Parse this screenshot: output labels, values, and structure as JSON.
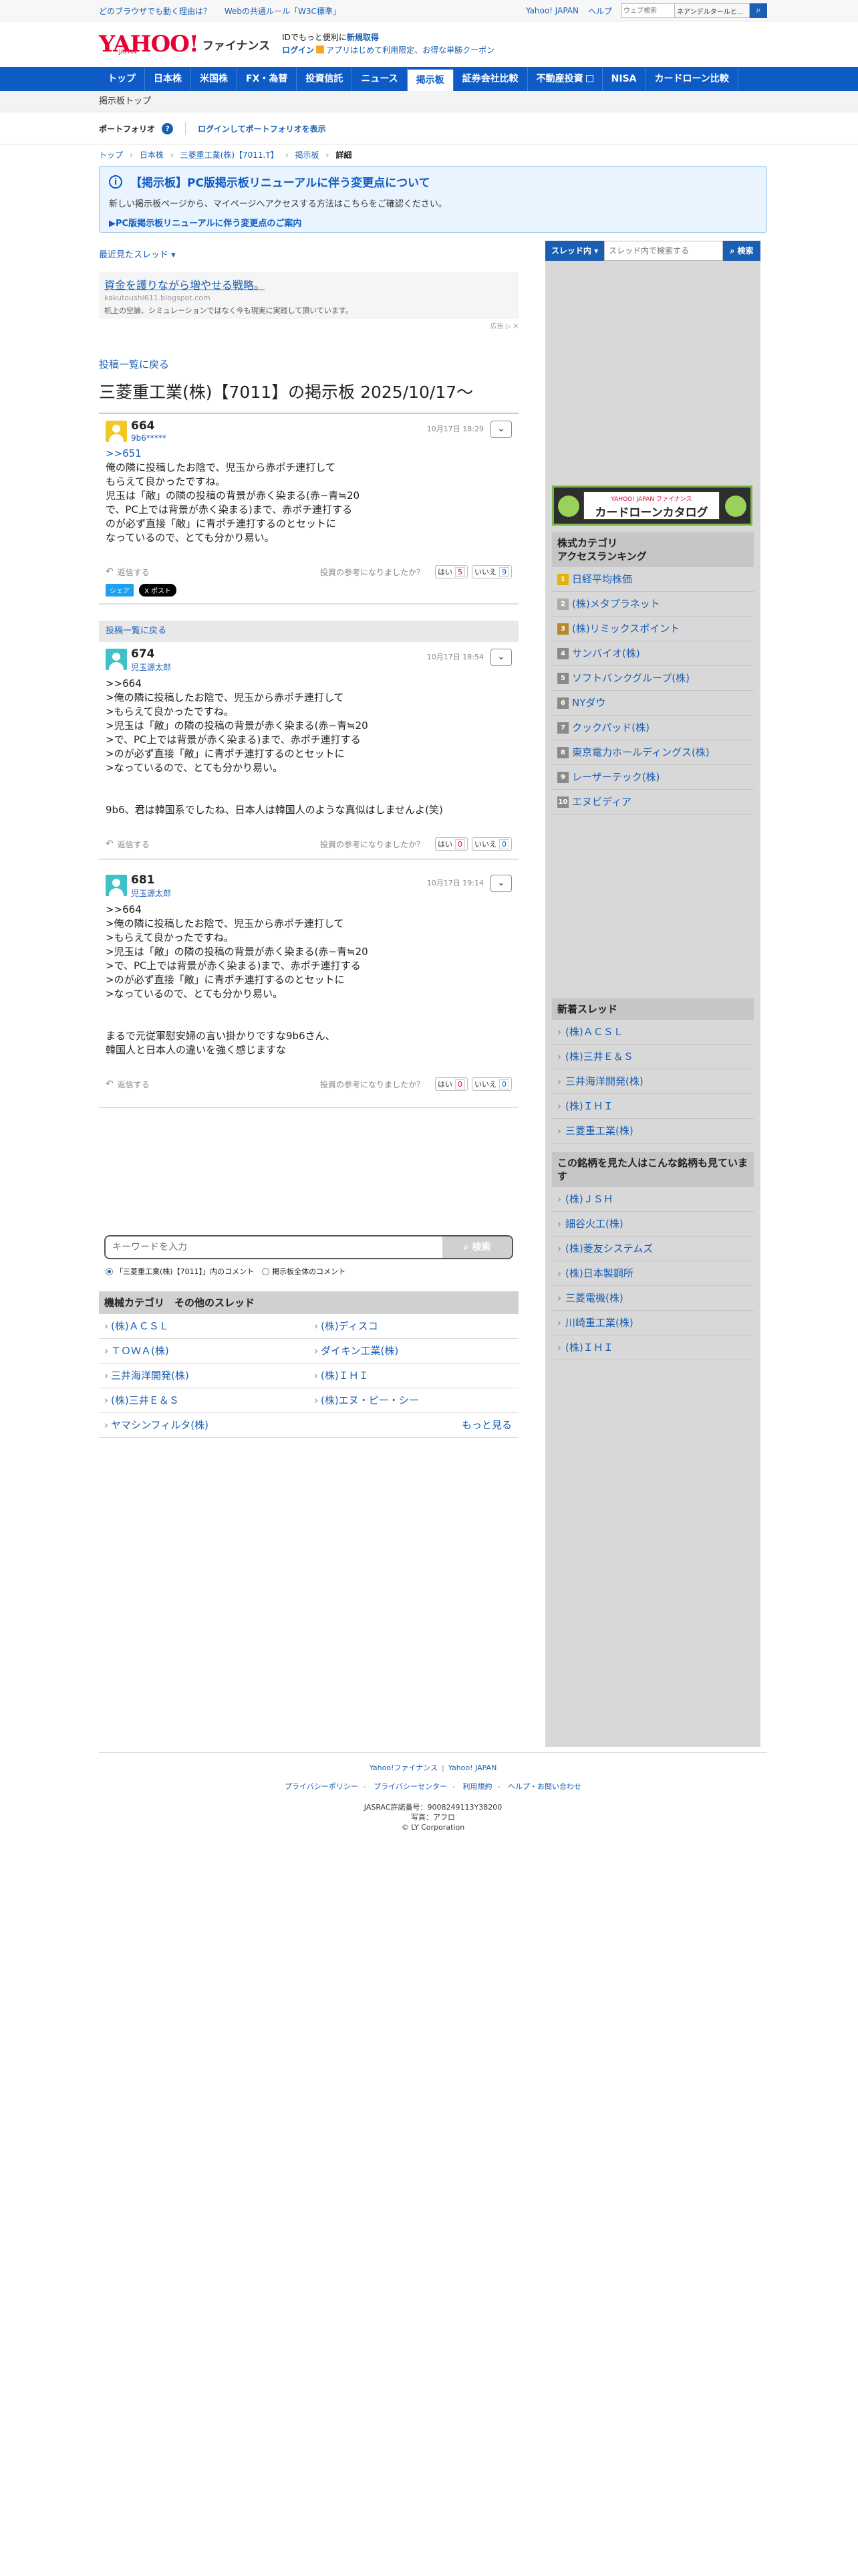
{
  "topbar": {
    "left_links": [
      "どのブラウザでも動く理由は？",
      "Webの共通ルール「W3C標準」"
    ],
    "right_links": [
      "Yahoo! JAPAN",
      "ヘルプ"
    ],
    "search_placeholder": "ウェブ検索",
    "search_select": "ネアンデルタールと...",
    "search_icon": "search-icon"
  },
  "header": {
    "logo_text": "YAHOO!",
    "logo_sub": "JAPAN",
    "logo_service": "ファイナンス",
    "promo_line1": "IDでもっと便利に",
    "promo_line1_link": "新規取得",
    "login": "ログイン",
    "promo_line2": "アプリはじめて利用限定、お得な単勝クーポン"
  },
  "gnav": {
    "items": [
      "トップ",
      "日本株",
      "米国株",
      "FX・為替",
      "投資信託",
      "ニュース",
      "掲示板",
      "証券会社比較",
      "不動産投資",
      "NISA",
      "カードローン比較"
    ],
    "active": "掲示板"
  },
  "subnav": {
    "label": "掲示板トップ"
  },
  "portfolio": {
    "label": "ポートフォリオ",
    "help": "?",
    "login_link": "ログインしてポートフォリオを表示"
  },
  "breadcrumb": {
    "items": [
      "トップ",
      "日本株",
      "三菱重工業(株)【7011.T】",
      "掲示板"
    ],
    "current": "詳細"
  },
  "notice": {
    "title": "【掲示板】PC版掲示板リニューアルに伴う変更点について",
    "desc": "新しい掲示板ページから、マイページへアクセスする方法はこちらをご確認ください。",
    "link": "▶PC版掲示板リニューアルに伴う変更点のご案内"
  },
  "main": {
    "recent_label": "最近見たスレッド",
    "ad": {
      "title": "資金を護りながら増やせる戦略。",
      "url": "kakutoushi611.blogspot.com",
      "desc": "机上の空論、シミュレーションではなく今も現実に実践して頂いています。",
      "chip": "広告"
    },
    "back_label": "投稿一覧に戻る",
    "page_title": "三菱重工業(株)【7011】の掲示板 2025/10/17〜",
    "posts": [
      {
        "num": "664",
        "user": "9b6*****",
        "date": "10月17日 18:29",
        "anchor": ">>651",
        "body": "俺の隣に投稿したお陰で、児玉から赤ポチ連打して\nもらえて良かったですね。\n児玉は「敵」の隣の投稿の背景が赤く染まる(赤−青≒20\nで、PC上では背景が赤く染まる)まで、赤ポチ連打する\nのが必ず直接「敵」に青ポチ連打するのとセットに\nなっているので、とても分かり易い。",
        "reply": "返信する",
        "question": "投資の参考になりましたか？",
        "yes_label": "はい",
        "yes_count": "5",
        "no_label": "いいえ",
        "no_count": "9",
        "share_fb": "シェア",
        "share_x": "ポスト"
      },
      {
        "num": "674",
        "user": "児玉源太郎",
        "date": "10月17日 18:54",
        "anchor": "",
        "body": ">>664\n>俺の隣に投稿したお陰で、児玉から赤ポチ連打して\n>もらえて良かったですね。\n>児玉は「敵」の隣の投稿の背景が赤く染まる(赤−青≒20\n>で、PC上では背景が赤く染まる)まで、赤ポチ連打する\n>のが必ず直接「敵」に青ポチ連打するのとセットに\n>なっているので、とても分かり易い。\n\n\n9b6、君は韓国系でしたね、日本人は韓国人のような真似はしませんよ(笑)",
        "reply": "返信する",
        "question": "投資の参考になりましたか？",
        "yes_label": "はい",
        "yes_count": "0",
        "no_label": "いいえ",
        "no_count": "0"
      },
      {
        "num": "681",
        "user": "児玉源太郎",
        "date": "10月17日 19:14",
        "anchor": "",
        "body": ">>664\n>俺の隣に投稿したお陰で、児玉から赤ポチ連打して\n>もらえて良かったですね。\n>児玉は「敵」の隣の投稿の背景が赤く染まる(赤−青≒20\n>で、PC上では背景が赤く染まる)まで、赤ポチ連打する\n>のが必ず直接「敵」に青ポチ連打するのとセットに\n>なっているので、とても分かり易い。\n\n\nまるで元従軍慰安婦の言い掛かりですな9b6さん、\n韓国人と日本人の違いを強く感じますな",
        "reply": "返信する",
        "question": "投資の参考になりましたか？",
        "yes_label": "はい",
        "yes_count": "0",
        "no_label": "いいえ",
        "no_count": "0"
      }
    ],
    "mid_back": "投稿一覧に戻る",
    "search": {
      "placeholder": "キーワードを入力",
      "button": "検索",
      "radio1": "「三菱重工業(株)【7011】」内のコメント",
      "radio2": "掲示板全体のコメント"
    },
    "category": {
      "title": "機械カテゴリ　その他のスレッド",
      "items": [
        "(株)ＡＣＳＬ",
        "(株)ディスコ",
        "ＴＯＷＡ(株)",
        "ダイキン工業(株)",
        "三井海洋開発(株)",
        "(株)ＩＨＩ",
        "(株)三井Ｅ＆Ｓ",
        "(株)エヌ・ピー・シー"
      ],
      "last": "ヤマシンフィルタ(株)",
      "more": "もっと見る"
    }
  },
  "side": {
    "search_select": "スレッド内",
    "search_placeholder": "スレッド内で検索する",
    "search_button": "検索",
    "ad_small": "YAHOO! JAPAN ファイナンス",
    "ad_title": "カードローンカタログ",
    "ranking_title": "株式カテゴリ\nアクセスランキング",
    "ranking": [
      "日経平均株価",
      "(株)メタプラネット",
      "(株)リミックスポイント",
      "サンバイオ(株)",
      "ソフトバンクグループ(株)",
      "NYダウ",
      "クックパッド(株)",
      "東京電力ホールディングス(株)",
      "レーザーテック(株)",
      "エヌビディア"
    ],
    "new_title": "新着スレッド",
    "new_threads": [
      "(株)ＡＣＳＬ",
      "(株)三井Ｅ＆Ｓ",
      "三井海洋開発(株)",
      "(株)ＩＨＩ",
      "三菱重工業(株)"
    ],
    "also_title": "この銘柄を見た人はこんな銘柄も見ています",
    "also": [
      "(株)ＪＳＨ",
      "細谷火工(株)",
      "(株)菱友システムズ",
      "(株)日本製鋼所",
      "三菱電機(株)",
      "川崎重工業(株)",
      "(株)ＩＨＩ"
    ]
  },
  "footer": {
    "links1": [
      "Yahoo!ファイナンス",
      "Yahoo! JAPAN"
    ],
    "links2": [
      "プライバシーポリシー",
      "プライバシーセンター",
      "利用規約",
      "ヘルプ・お問い合わせ"
    ],
    "jasrac": "JASRAC許諾番号：9008249113Y38200",
    "photo": "写真：アフロ",
    "copyright": "© LY Corporation"
  }
}
